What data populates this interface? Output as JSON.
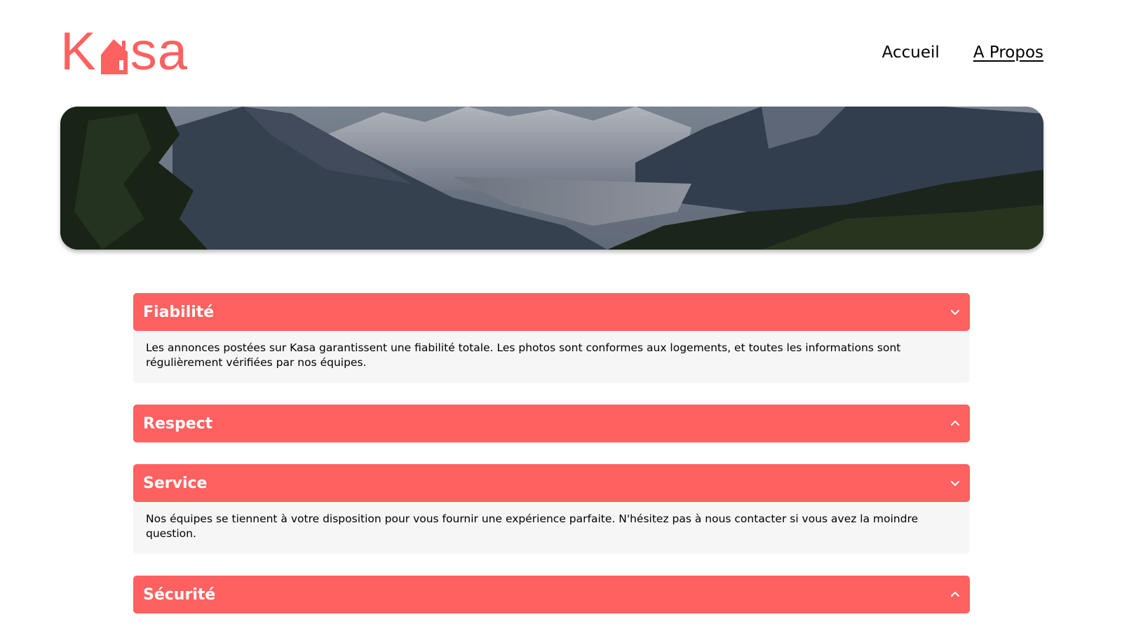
{
  "header": {
    "logo": {
      "letters": [
        "K",
        "s",
        "a"
      ],
      "icon": "house-icon",
      "color": "#FF6060"
    },
    "nav": [
      {
        "label": "Accueil",
        "active": false
      },
      {
        "label": "A Propos",
        "active": true
      }
    ]
  },
  "banner": {
    "image": "mountain-valley-landscape"
  },
  "collapses": [
    {
      "title": "Fiabilité",
      "open": true,
      "icon": "chevron-down-icon",
      "text": "Les annonces postées sur Kasa garantissent une fiabilité totale. Les photos sont conformes aux logements, et toutes les informations sont régulièrement vérifiées par nos équipes."
    },
    {
      "title": "Respect",
      "open": false,
      "icon": "chevron-up-icon",
      "text": ""
    },
    {
      "title": "Service",
      "open": true,
      "icon": "chevron-down-icon",
      "text": "Nos équipes se tiennent à votre disposition pour vous fournir une expérience parfaite. N'hésitez pas à nous contacter si vous avez la moindre question."
    },
    {
      "title": "Sécurité",
      "open": false,
      "icon": "chevron-up-icon",
      "text": ""
    }
  ],
  "colors": {
    "accent": "#FF6060",
    "panel": "#F6F6F6"
  }
}
